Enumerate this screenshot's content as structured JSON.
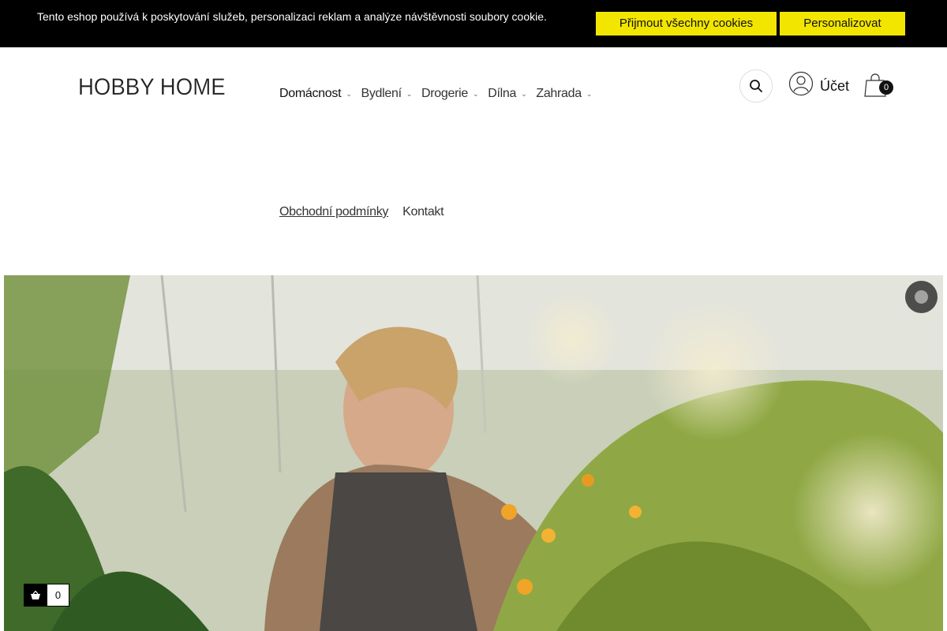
{
  "cookie_bar": {
    "text": "Tento eshop používá k poskytování služeb, personalizaci reklam a analýze návštěvnosti soubory cookie.",
    "accept_label": "Přijmout všechny cookies",
    "personalize_label": "Personalizovat",
    "accent_color": "#f2e600"
  },
  "header": {
    "logo": "HOBBY HOME",
    "nav": [
      {
        "label": "Domácnost",
        "icon": "chevron-down-icon"
      },
      {
        "label": "Bydlení",
        "icon": "chevron-down-icon"
      },
      {
        "label": "Drogerie",
        "icon": "chevron-down-icon"
      },
      {
        "label": "Dílna",
        "icon": "chevron-down-icon"
      },
      {
        "label": "Zahrada",
        "icon": "chevron-down-icon"
      }
    ],
    "search_icon": "search-icon",
    "account_label": "Účet",
    "cart_count": "0"
  },
  "secondary_nav": {
    "terms_label": "Obchodní podmínky",
    "contact_label": "Kontakt"
  },
  "hero": {
    "image_description_icon": "hero-photo",
    "mini_cart_count": "0"
  }
}
